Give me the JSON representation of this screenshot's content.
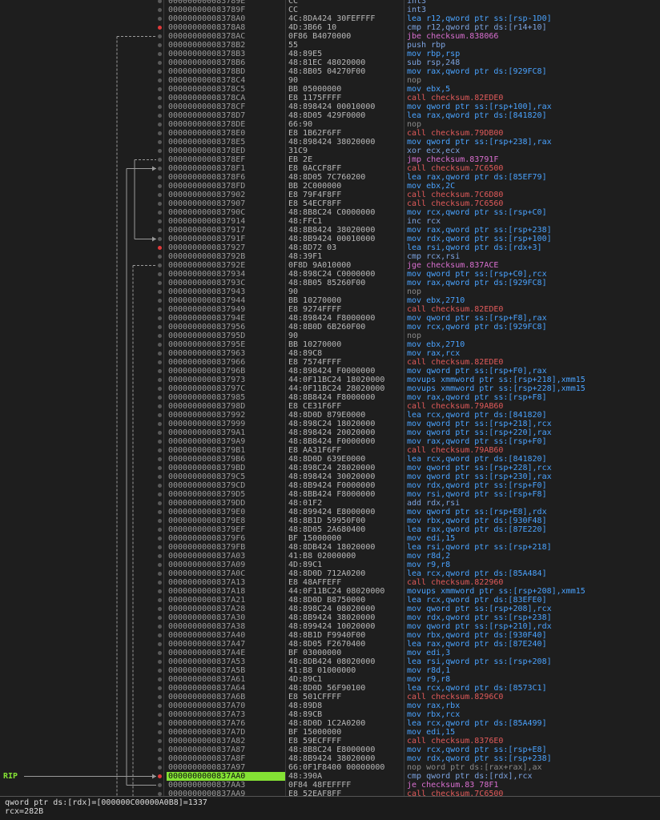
{
  "rip_label": "RIP",
  "rip_index": 88,
  "breakpoint_indices": [
    3,
    28,
    88
  ],
  "info": {
    "line1": "qword ptr ds:[rdx]=[000000C00000A0B8]=1337",
    "line2": "rcx=282B"
  },
  "rows": [
    {
      "a": "000000000083789E",
      "b": "CC",
      "m": "int3"
    },
    {
      "a": "000000000083789F",
      "b": "CC",
      "m": "int3"
    },
    {
      "a": "00000000008378A0",
      "b": "4C:8DA424 30FEFFFF",
      "m": "lea r12,qword ptr ss:[rsp-1D0]"
    },
    {
      "a": "00000000008378A8",
      "b": "4D:3B66 10",
      "m": "cmp r12,qword ptr ds:[r14+10]"
    },
    {
      "a": "00000000008378AC",
      "b": "0F86 B4070000",
      "m": "jbe checksum.838066"
    },
    {
      "a": "00000000008378B2",
      "b": "55",
      "m": "push rbp"
    },
    {
      "a": "00000000008378B3",
      "b": "48:89E5",
      "m": "mov rbp,rsp"
    },
    {
      "a": "00000000008378B6",
      "b": "48:81EC 48020000",
      "m": "sub rsp,248"
    },
    {
      "a": "00000000008378BD",
      "b": "48:8B05 04270F00",
      "m": "mov rax,qword ptr ds:[929FC8]"
    },
    {
      "a": "00000000008378C4",
      "b": "90",
      "m": "nop"
    },
    {
      "a": "00000000008378C5",
      "b": "BB 05000000",
      "m": "mov ebx,5"
    },
    {
      "a": "00000000008378CA",
      "b": "E8 1175FFFF",
      "m": "call checksum.82EDE0"
    },
    {
      "a": "00000000008378CF",
      "b": "48:898424 00010000",
      "m": "mov qword ptr ss:[rsp+100],rax"
    },
    {
      "a": "00000000008378D7",
      "b": "48:8D05 429F0000",
      "m": "lea rax,qword ptr ds:[841820]"
    },
    {
      "a": "00000000008378DE",
      "b": "66:90",
      "m": "nop"
    },
    {
      "a": "00000000008378E0",
      "b": "E8 1B62F6FF",
      "m": "call checksum.79DB00"
    },
    {
      "a": "00000000008378E5",
      "b": "48:898424 38020000",
      "m": "mov qword ptr ss:[rsp+238],rax"
    },
    {
      "a": "00000000008378ED",
      "b": "31C9",
      "m": "xor ecx,ecx"
    },
    {
      "a": "00000000008378EF",
      "b": "EB 2E",
      "m": "jmp checksum.83791F"
    },
    {
      "a": "00000000008378F1",
      "b": "E8 0ACCF8FF",
      "m": "call checksum.7C6500"
    },
    {
      "a": "00000000008378F6",
      "b": "48:8D05 7C760200",
      "m": "lea rax,qword ptr ds:[85EF79]"
    },
    {
      "a": "00000000008378FD",
      "b": "BB 2C000000",
      "m": "mov ebx,2C"
    },
    {
      "a": "0000000000837902",
      "b": "E8 79F4F8FF",
      "m": "call checksum.7C6D80"
    },
    {
      "a": "0000000000837907",
      "b": "E8 54ECF8FF",
      "m": "call checksum.7C6560"
    },
    {
      "a": "000000000083790C",
      "b": "48:8B8C24 C0000000",
      "m": "mov rcx,qword ptr ss:[rsp+C0]"
    },
    {
      "a": "0000000000837914",
      "b": "48:FFC1",
      "m": "inc rcx"
    },
    {
      "a": "0000000000837917",
      "b": "48:8B8424 38020000",
      "m": "mov rax,qword ptr ss:[rsp+238]"
    },
    {
      "a": "000000000083791F",
      "b": "48:8B9424 00010000",
      "m": "mov rdx,qword ptr ss:[rsp+100]"
    },
    {
      "a": "0000000000837927",
      "b": "48:8D72 03",
      "m": "lea rsi,qword ptr ds:[rdx+3]"
    },
    {
      "a": "000000000083792B",
      "b": "48:39F1",
      "m": "cmp rcx,rsi"
    },
    {
      "a": "000000000083792E",
      "b": "0F8D 9A010000",
      "m": "jge checksum.837ACE"
    },
    {
      "a": "0000000000837934",
      "b": "48:898C24 C0000000",
      "m": "mov qword ptr ss:[rsp+C0],rcx"
    },
    {
      "a": "000000000083793C",
      "b": "48:8B05 85260F00",
      "m": "mov rax,qword ptr ds:[929FC8]"
    },
    {
      "a": "0000000000837943",
      "b": "90",
      "m": "nop"
    },
    {
      "a": "0000000000837944",
      "b": "BB 10270000",
      "m": "mov ebx,2710"
    },
    {
      "a": "0000000000837949",
      "b": "E8 9274FFFF",
      "m": "call checksum.82EDE0"
    },
    {
      "a": "000000000083794E",
      "b": "48:898424 F8000000",
      "m": "mov qword ptr ss:[rsp+F8],rax"
    },
    {
      "a": "0000000000837956",
      "b": "48:8B0D 6B260F00",
      "m": "mov rcx,qword ptr ds:[929FC8]"
    },
    {
      "a": "000000000083795D",
      "b": "90",
      "m": "nop"
    },
    {
      "a": "000000000083795E",
      "b": "BB 10270000",
      "m": "mov ebx,2710"
    },
    {
      "a": "0000000000837963",
      "b": "48:89C8",
      "m": "mov rax,rcx"
    },
    {
      "a": "0000000000837966",
      "b": "E8 7574FFFF",
      "m": "call checksum.82EDE0"
    },
    {
      "a": "000000000083796B",
      "b": "48:898424 F0000000",
      "m": "mov qword ptr ss:[rsp+F0],rax"
    },
    {
      "a": "0000000000837973",
      "b": "44:0F11BC24 18020000",
      "m": "movups xmmword ptr ss:[rsp+218],xmm15"
    },
    {
      "a": "000000000083797C",
      "b": "44:0F11BC24 28020000",
      "m": "movups xmmword ptr ss:[rsp+228],xmm15"
    },
    {
      "a": "0000000000837985",
      "b": "48:8B8424 F8000000",
      "m": "mov rax,qword ptr ss:[rsp+F8]"
    },
    {
      "a": "000000000083798D",
      "b": "E8 CE31F6FF",
      "m": "call checksum.79AB60"
    },
    {
      "a": "0000000000837992",
      "b": "48:8D0D 879E0000",
      "m": "lea rcx,qword ptr ds:[841820]"
    },
    {
      "a": "0000000000837999",
      "b": "48:898C24 18020000",
      "m": "mov qword ptr ss:[rsp+218],rcx"
    },
    {
      "a": "00000000008379A1",
      "b": "48:898424 20020000",
      "m": "mov qword ptr ss:[rsp+220],rax"
    },
    {
      "a": "00000000008379A9",
      "b": "48:8B8424 F0000000",
      "m": "mov rax,qword ptr ss:[rsp+F0]"
    },
    {
      "a": "00000000008379B1",
      "b": "E8 AA31F6FF",
      "m": "call checksum.79AB60"
    },
    {
      "a": "00000000008379B6",
      "b": "48:8D0D 639E0000",
      "m": "lea rcx,qword ptr ds:[841820]"
    },
    {
      "a": "00000000008379BD",
      "b": "48:898C24 28020000",
      "m": "mov qword ptr ss:[rsp+228],rcx"
    },
    {
      "a": "00000000008379C5",
      "b": "48:898424 30020000",
      "m": "mov qword ptr ss:[rsp+230],rax"
    },
    {
      "a": "00000000008379CD",
      "b": "48:8B9424 F0000000",
      "m": "mov rdx,qword ptr ss:[rsp+F0]"
    },
    {
      "a": "00000000008379D5",
      "b": "48:8BB424 F8000000",
      "m": "mov rsi,qword ptr ss:[rsp+F8]"
    },
    {
      "a": "00000000008379DD",
      "b": "48:01F2",
      "m": "add rdx,rsi"
    },
    {
      "a": "00000000008379E0",
      "b": "48:899424 E8000000",
      "m": "mov qword ptr ss:[rsp+E8],rdx"
    },
    {
      "a": "00000000008379E8",
      "b": "48:8B1D 59950F00",
      "m": "mov rbx,qword ptr ds:[930F48]"
    },
    {
      "a": "00000000008379EF",
      "b": "48:8D05 2A680400",
      "m": "lea rax,qword ptr ds:[87E220]"
    },
    {
      "a": "00000000008379F6",
      "b": "BF 15000000",
      "m": "mov edi,15"
    },
    {
      "a": "00000000008379FB",
      "b": "48:8DB424 18020000",
      "m": "lea rsi,qword ptr ss:[rsp+218]"
    },
    {
      "a": "0000000000837A03",
      "b": "41:B8 02000000",
      "m": "mov r8d,2"
    },
    {
      "a": "0000000000837A09",
      "b": "4D:89C1",
      "m": "mov r9,r8"
    },
    {
      "a": "0000000000837A0C",
      "b": "48:8D0D 712A0200",
      "m": "lea rcx,qword ptr ds:[85A484]"
    },
    {
      "a": "0000000000837A13",
      "b": "E8 48AFFEFF",
      "m": "call checksum.822960"
    },
    {
      "a": "0000000000837A18",
      "b": "44:0F11BC24 08020000",
      "m": "movups xmmword ptr ss:[rsp+208],xmm15"
    },
    {
      "a": "0000000000837A21",
      "b": "48:8D0D B8750000",
      "m": "lea rcx,qword ptr ds:[83EFE0]"
    },
    {
      "a": "0000000000837A28",
      "b": "48:898C24 08020000",
      "m": "mov qword ptr ss:[rsp+208],rcx"
    },
    {
      "a": "0000000000837A30",
      "b": "48:8B9424 38020000",
      "m": "mov rdx,qword ptr ss:[rsp+238]"
    },
    {
      "a": "0000000000837A38",
      "b": "48:899424 10020000",
      "m": "mov qword ptr ss:[rsp+210],rdx"
    },
    {
      "a": "0000000000837A40",
      "b": "48:8B1D F9940F00",
      "m": "mov rbx,qword ptr ds:[930F40]"
    },
    {
      "a": "0000000000837A47",
      "b": "48:8D05 F2670400",
      "m": "lea rax,qword ptr ds:[87E240]"
    },
    {
      "a": "0000000000837A4E",
      "b": "BF 03000000",
      "m": "mov edi,3"
    },
    {
      "a": "0000000000837A53",
      "b": "48:8DB424 08020000",
      "m": "lea rsi,qword ptr ss:[rsp+208]"
    },
    {
      "a": "0000000000837A5B",
      "b": "41:B8 01000000",
      "m": "mov r8d,1"
    },
    {
      "a": "0000000000837A61",
      "b": "4D:89C1",
      "m": "mov r9,r8"
    },
    {
      "a": "0000000000837A64",
      "b": "48:8D0D 56F90100",
      "m": "lea rcx,qword ptr ds:[8573C1]"
    },
    {
      "a": "0000000000837A6B",
      "b": "E8 501CFFFF",
      "m": "call checksum.8296C0"
    },
    {
      "a": "0000000000837A70",
      "b": "48:89D8",
      "m": "mov rax,rbx"
    },
    {
      "a": "0000000000837A73",
      "b": "48:89CB",
      "m": "mov rbx,rcx"
    },
    {
      "a": "0000000000837A76",
      "b": "48:8D0D 1C2A0200",
      "m": "lea rcx,qword ptr ds:[85A499]"
    },
    {
      "a": "0000000000837A7D",
      "b": "BF 15000000",
      "m": "mov edi,15"
    },
    {
      "a": "0000000000837A82",
      "b": "E8 59ECFFFF",
      "m": "call checksum.8376E0"
    },
    {
      "a": "0000000000837A87",
      "b": "48:8B8C24 E8000000",
      "m": "mov rcx,qword ptr ss:[rsp+E8]"
    },
    {
      "a": "0000000000837A8F",
      "b": "48:8B9424 38020000",
      "m": "mov rdx,qword ptr ss:[rsp+238]"
    },
    {
      "a": "0000000000837A97",
      "b": "66:0F1F8400 00000000",
      "m": "nop word ptr ds:[rax+rax],ax"
    },
    {
      "a": "0000000000837AA0",
      "b": "48:390A",
      "m": "cmp qword ptr ds:[rdx],rcx"
    },
    {
      "a": "0000000000837AA3",
      "b": "0F84 48FEFFFF",
      "m": "je checksum.83 78F1"
    },
    {
      "a": "0000000000837AA9",
      "b": "E8 52EAF8FF",
      "m": "call checksum.7C6500"
    }
  ]
}
